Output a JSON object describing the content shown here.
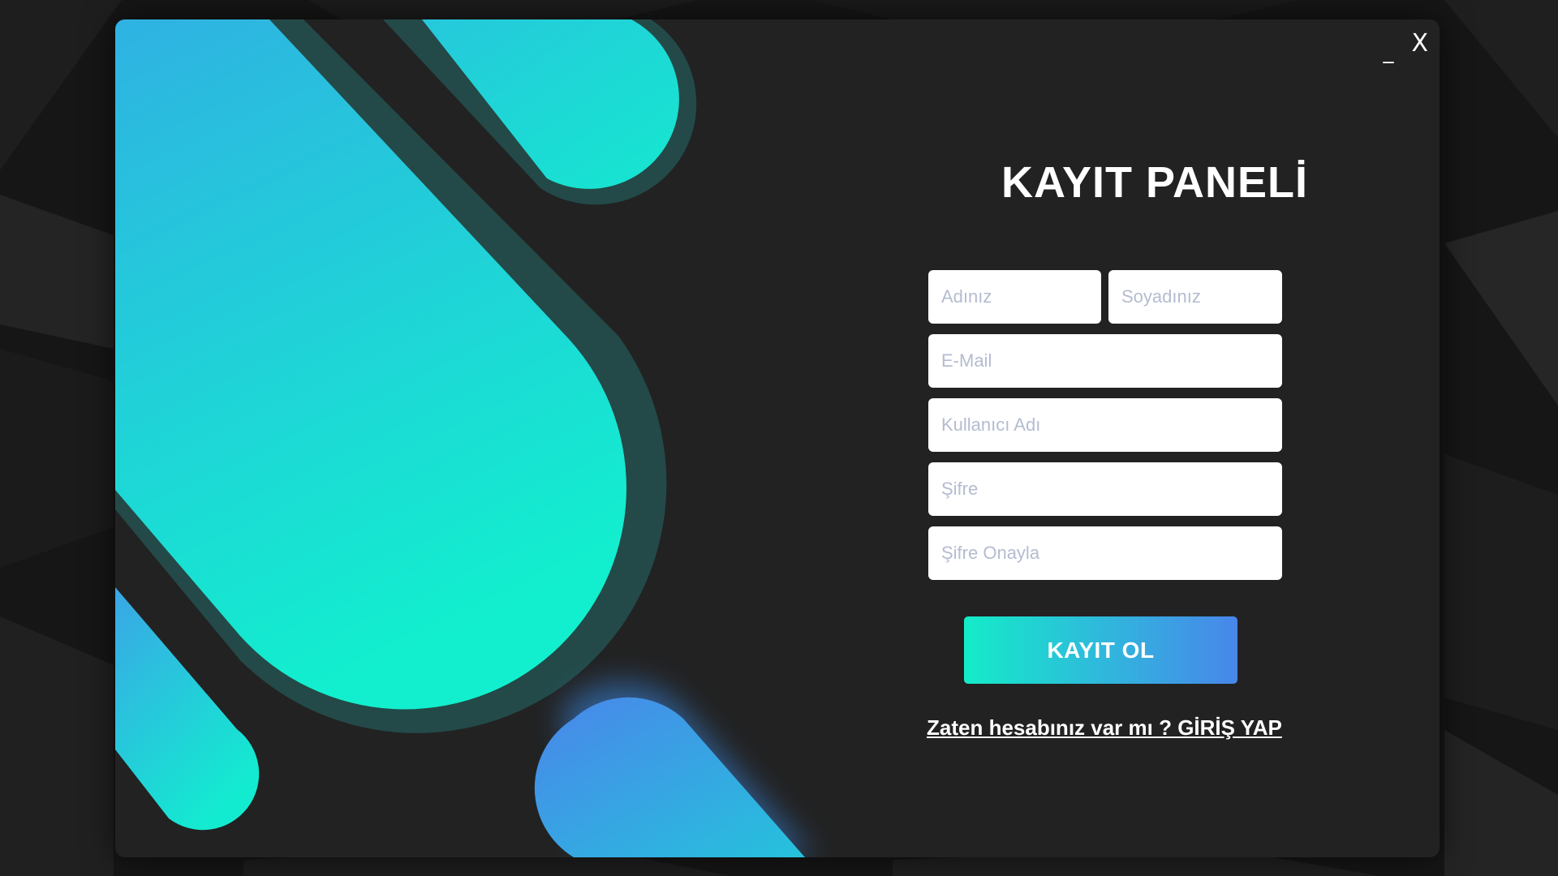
{
  "window": {
    "title": "KAYIT PANELİ",
    "minimize_label": "_",
    "close_label": "X"
  },
  "form": {
    "first_name_placeholder": "Adınız",
    "last_name_placeholder": "Soyadınız",
    "email_placeholder": "E-Mail",
    "username_placeholder": "Kullanıcı Adı",
    "password_placeholder": "Şifre",
    "password_confirm_placeholder": "Şifre Onayla",
    "first_name_value": "",
    "last_name_value": "",
    "email_value": "",
    "username_value": "",
    "password_value": "",
    "password_confirm_value": "",
    "submit_label": "KAYIT OL",
    "login_link_text": "Zaten hesabınız var mı ? GİRİŞ YAP"
  },
  "colors": {
    "accent_teal": "#14ecc8",
    "accent_cyan": "#2fb9dc",
    "accent_blue": "#4886ea",
    "window_bg": "#222222",
    "text": "#ffffff"
  },
  "icons": {
    "close": "close-icon",
    "minimize": "minimize-icon"
  }
}
